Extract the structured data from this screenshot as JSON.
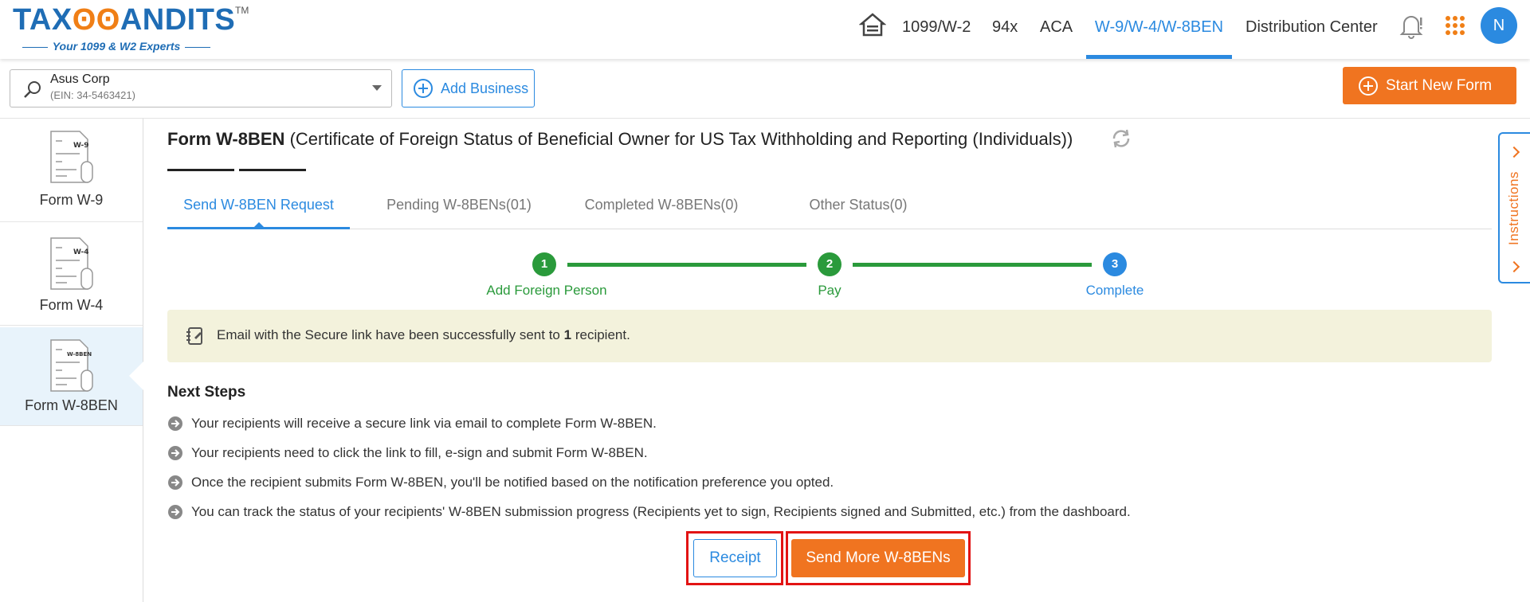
{
  "header": {
    "logo": {
      "main_left": "TAX",
      "main_owl": "ʘʘ",
      "main_right": "ANDITS",
      "tm": "TM",
      "tagline": "Your 1099 & W2 Experts"
    },
    "nav": [
      {
        "label": "1099/W-2"
      },
      {
        "label": "94x"
      },
      {
        "label": "ACA"
      },
      {
        "label": "W-9/W-4/W-8BEN",
        "active": true
      },
      {
        "label": "Distribution Center"
      }
    ],
    "icons": [
      "home-icon",
      "bell-icon",
      "apps-grid-icon"
    ],
    "avatar_initial": "N"
  },
  "toolbar": {
    "business_name": "Asus Corp",
    "business_ein": "(EIN: 34-5463421)",
    "add_business_label": "Add Business",
    "start_new_form_label": "Start New Form"
  },
  "sidebar": {
    "items": [
      {
        "label": "Form W-9",
        "doc_tag": "W-9"
      },
      {
        "label": "Form W-4",
        "doc_tag": "W-4"
      },
      {
        "label": "Form W-8BEN",
        "doc_tag": "W-8BEN",
        "active": true
      }
    ]
  },
  "main": {
    "title_bold": "Form W-8BEN",
    "title_rest": "(Certificate of Foreign Status of Beneficial Owner for US Tax Withholding and Reporting (Individuals))",
    "tabs": [
      {
        "label": "Send W-8BEN Request",
        "active": true
      },
      {
        "label": "Pending W-8BENs(01)"
      },
      {
        "label": "Completed W-8BENs(0)"
      },
      {
        "label": "Other Status(0)"
      }
    ],
    "stepper": [
      {
        "num": "1",
        "label": "Add Foreign Person"
      },
      {
        "num": "2",
        "label": "Pay"
      },
      {
        "num": "3",
        "label": "Complete"
      }
    ],
    "alert": {
      "before": "Email with the Secure link have been successfully sent to",
      "count": "1",
      "after": "recipient."
    },
    "next_steps_title": "Next Steps",
    "next_steps": [
      "Your recipients will receive a secure link via email to complete Form W-8BEN.",
      "Your recipients need to click the link to fill, e-sign and submit Form W-8BEN.",
      "Once the recipient submits Form W-8BEN, you'll be notified based on the notification preference you opted.",
      "You can track the status of your recipients' W-8BEN submission progress (Recipients yet to sign, Recipients signed and Submitted, etc.) from the dashboard."
    ],
    "receipt_label": "Receipt",
    "send_more_label": "Send More W-8BENs"
  },
  "instructions_label": "Instructions",
  "colors": {
    "brand_blue": "#2b8ae0",
    "brand_orange": "#f07420",
    "step_green": "#2a9a3b",
    "alert_bg": "#f3f2dc",
    "highlight_red": "#e21313"
  }
}
